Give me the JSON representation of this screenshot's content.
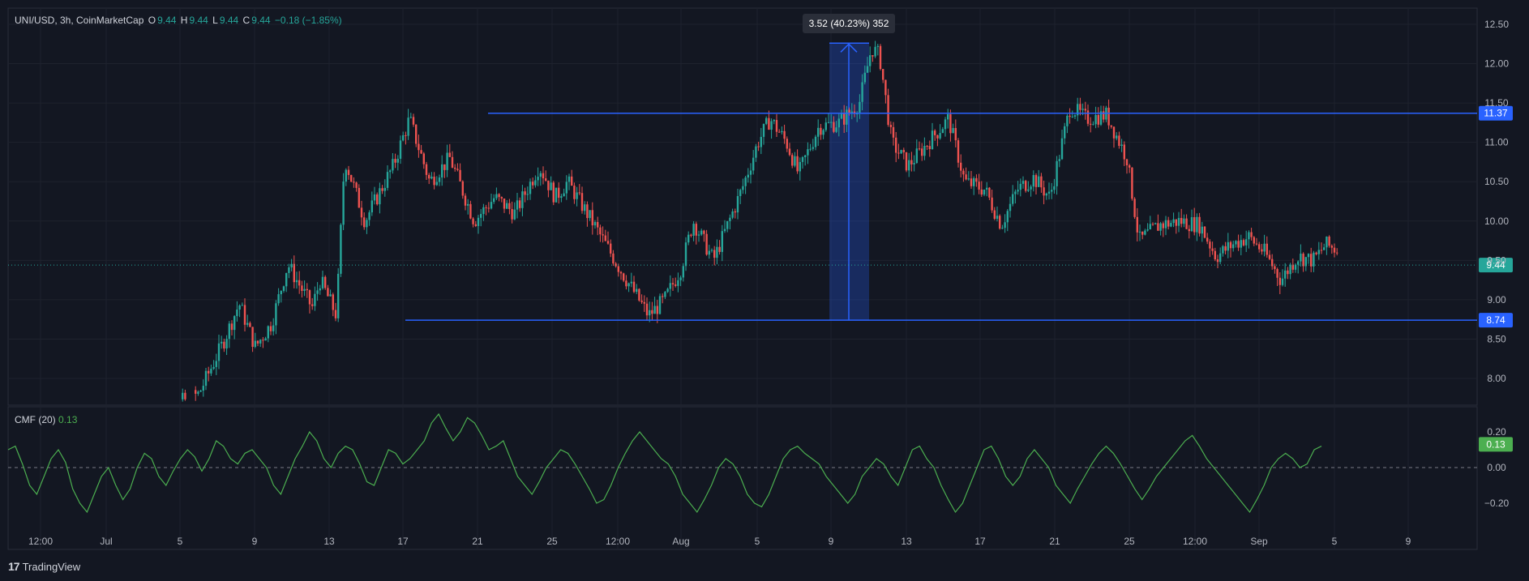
{
  "header": {
    "symbol": "UNI/USD, 3h, CoinMarketCap",
    "open_label": "O",
    "open": "9.44",
    "high_label": "H",
    "high": "9.44",
    "low_label": "L",
    "low": "9.44",
    "close_label": "C",
    "close": "9.44",
    "change": "−0.18 (−1.85%)"
  },
  "indicator": {
    "name": "CMF (20)",
    "value": "0.13"
  },
  "brand": {
    "name": "TradingView",
    "icon": "tradingview-logo-icon"
  },
  "colors": {
    "bg": "#131722",
    "up": "#26a69a",
    "down": "#ef5350",
    "level": "#2962ff",
    "measure": "#2962ff",
    "cmf": "#4caf50",
    "last_price": "#26a69a"
  },
  "chart_data": [
    {
      "type": "candlestick",
      "title": "UNI/USD, 3h, CoinMarketCap",
      "y_ticks": [
        "8.00",
        "8.50",
        "9.00",
        "9.50",
        "10.00",
        "10.50",
        "11.00",
        "11.50",
        "12.00",
        "12.50"
      ],
      "ylim": [
        7.6,
        12.7
      ],
      "x_ticks": [
        "12:00",
        "Jul",
        "5",
        "9",
        "13",
        "17",
        "21",
        "25",
        "12:00",
        "Aug",
        "5",
        "9",
        "13",
        "17",
        "21",
        "25",
        "12:00",
        "Sep",
        "5",
        "9"
      ],
      "grid": true,
      "horizontal_levels": [
        {
          "value": 11.37,
          "label": "11.37"
        },
        {
          "value": 8.74,
          "label": "8.74"
        }
      ],
      "last_price": {
        "value": 9.44,
        "label": "9.44"
      },
      "measure": {
        "from": 8.74,
        "to": 12.26,
        "label": "3.52 (40.23%) 352"
      },
      "price_path_anchors": [
        [
          0.0,
          7.55
        ],
        [
          0.11,
          7.62
        ],
        [
          0.11,
          7.85
        ],
        [
          0.18,
          7.55
        ],
        [
          0.235,
          7.8
        ],
        [
          0.265,
          8.45
        ],
        [
          0.285,
          8.95
        ],
        [
          0.305,
          8.4
        ],
        [
          0.325,
          8.7
        ],
        [
          0.345,
          9.45
        ],
        [
          0.375,
          8.9
        ],
        [
          0.385,
          9.25
        ],
        [
          0.405,
          8.8
        ],
        [
          0.415,
          10.8
        ],
        [
          0.44,
          10.0
        ],
        [
          0.475,
          10.7
        ],
        [
          0.495,
          11.3
        ],
        [
          0.52,
          10.5
        ],
        [
          0.545,
          10.8
        ],
        [
          0.575,
          10.0
        ],
        [
          0.6,
          10.3
        ],
        [
          0.625,
          10.1
        ],
        [
          0.655,
          10.7
        ],
        [
          0.675,
          10.3
        ],
        [
          0.69,
          10.5
        ],
        [
          0.72,
          10.0
        ],
        [
          0.76,
          9.3
        ],
        [
          0.79,
          8.8
        ],
        [
          0.81,
          9.0
        ],
        [
          0.83,
          9.4
        ],
        [
          0.845,
          10.0
        ],
        [
          0.87,
          9.5
        ],
        [
          0.905,
          10.4
        ],
        [
          0.925,
          11.0
        ],
        [
          0.94,
          11.3
        ],
        [
          0.96,
          11.0
        ],
        [
          0.975,
          10.6
        ],
        [
          1.0,
          11.2
        ],
        [
          1.025,
          11.25
        ],
        [
          1.05,
          11.5
        ],
        [
          1.065,
          12.2
        ],
        [
          1.075,
          12.1
        ],
        [
          1.09,
          11.0
        ],
        [
          1.11,
          10.7
        ],
        [
          1.135,
          11.0
        ],
        [
          1.16,
          11.3
        ],
        [
          1.18,
          10.5
        ],
        [
          1.205,
          10.4
        ],
        [
          1.225,
          9.95
        ],
        [
          1.245,
          10.4
        ],
        [
          1.265,
          10.55
        ],
        [
          1.285,
          10.3
        ],
        [
          1.31,
          11.45
        ],
        [
          1.33,
          11.3
        ],
        [
          1.355,
          11.35
        ],
        [
          1.38,
          10.8
        ],
        [
          1.395,
          9.75
        ],
        [
          1.42,
          9.95
        ],
        [
          1.445,
          10.0
        ],
        [
          1.47,
          9.95
        ],
        [
          1.49,
          9.55
        ],
        [
          1.51,
          9.7
        ],
        [
          1.53,
          9.8
        ],
        [
          1.55,
          9.6
        ],
        [
          1.57,
          9.25
        ],
        [
          1.59,
          9.55
        ],
        [
          1.61,
          9.5
        ],
        [
          1.625,
          9.7
        ],
        [
          1.64,
          9.63
        ]
      ]
    },
    {
      "type": "line",
      "title": "CMF (20)",
      "y_ticks": [
        "0.20",
        "0.00",
        "−0.20"
      ],
      "ylim": [
        -0.35,
        0.35
      ],
      "last_value": {
        "value": 0.13,
        "label": "0.13"
      },
      "zero_line": true,
      "series": [
        {
          "values": [
            0.1,
            0.12,
            0.02,
            -0.1,
            -0.15,
            -0.05,
            0.05,
            0.1,
            0.03,
            -0.12,
            -0.2,
            -0.25,
            -0.15,
            -0.05,
            0.0,
            -0.1,
            -0.18,
            -0.12,
            0.0,
            0.08,
            0.05,
            -0.05,
            -0.1,
            -0.02,
            0.05,
            0.1,
            0.06,
            -0.02,
            0.05,
            0.15,
            0.12,
            0.05,
            0.02,
            0.08,
            0.1,
            0.05,
            0.0,
            -0.1,
            -0.15,
            -0.05,
            0.05,
            0.12,
            0.2,
            0.15,
            0.05,
            0.0,
            0.08,
            0.12,
            0.1,
            0.02,
            -0.08,
            -0.1,
            0.0,
            0.1,
            0.08,
            0.02,
            0.05,
            0.1,
            0.15,
            0.25,
            0.3,
            0.22,
            0.15,
            0.2,
            0.28,
            0.25,
            0.18,
            0.1,
            0.12,
            0.15,
            0.05,
            -0.05,
            -0.1,
            -0.15,
            -0.08,
            0.0,
            0.05,
            0.1,
            0.08,
            0.02,
            -0.05,
            -0.12,
            -0.2,
            -0.18,
            -0.1,
            0.0,
            0.08,
            0.15,
            0.2,
            0.15,
            0.1,
            0.05,
            0.02,
            -0.05,
            -0.15,
            -0.2,
            -0.25,
            -0.18,
            -0.1,
            0.0,
            0.05,
            0.02,
            -0.05,
            -0.15,
            -0.2,
            -0.22,
            -0.15,
            -0.05,
            0.05,
            0.1,
            0.12,
            0.08,
            0.05,
            0.02,
            -0.05,
            -0.1,
            -0.15,
            -0.2,
            -0.15,
            -0.05,
            0.0,
            0.05,
            0.02,
            -0.05,
            -0.1,
            0.0,
            0.1,
            0.12,
            0.05,
            0.0,
            -0.1,
            -0.18,
            -0.25,
            -0.2,
            -0.1,
            0.0,
            0.1,
            0.12,
            0.05,
            -0.05,
            -0.1,
            -0.05,
            0.05,
            0.1,
            0.05,
            0.0,
            -0.1,
            -0.15,
            -0.2,
            -0.12,
            -0.05,
            0.02,
            0.08,
            0.12,
            0.08,
            0.02,
            -0.05,
            -0.12,
            -0.18,
            -0.12,
            -0.05,
            0.0,
            0.05,
            0.1,
            0.15,
            0.18,
            0.12,
            0.05,
            0.0,
            -0.05,
            -0.1,
            -0.15,
            -0.2,
            -0.25,
            -0.18,
            -0.1,
            0.0,
            0.05,
            0.08,
            0.05,
            0.0,
            0.02,
            0.1,
            0.12
          ]
        }
      ]
    }
  ]
}
